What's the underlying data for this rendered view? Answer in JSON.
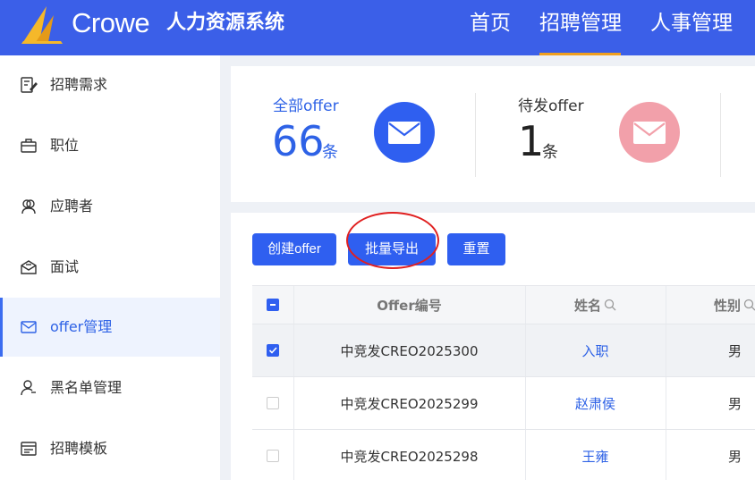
{
  "header": {
    "brand": "Crowe",
    "system_title": "人力资源系统",
    "nav": [
      {
        "label": "首页"
      },
      {
        "label": "招聘管理",
        "active": true
      },
      {
        "label": "人事管理"
      }
    ],
    "colors": {
      "bar": "#3b5fe8",
      "active_underline": "#f0a020"
    }
  },
  "sidebar": {
    "items": [
      {
        "label": "招聘需求",
        "icon": "edit-document-icon"
      },
      {
        "label": "职位",
        "icon": "briefcase-icon"
      },
      {
        "label": "应聘者",
        "icon": "users-icon"
      },
      {
        "label": "面试",
        "icon": "mail-open-icon"
      },
      {
        "label": "offer管理",
        "icon": "mail-icon",
        "active": true
      },
      {
        "label": "黑名单管理",
        "icon": "user-block-icon"
      },
      {
        "label": "招聘模板",
        "icon": "template-icon"
      }
    ]
  },
  "stats": [
    {
      "label": "全部offer",
      "value": "66",
      "unit": "条",
      "icon": "mail-icon",
      "color": "#2f5ff0"
    },
    {
      "label": "待发offer",
      "value": "1",
      "unit": "条",
      "icon": "mail-icon",
      "color": "#f2a0aa"
    }
  ],
  "toolbar": {
    "create_label": "创建offer",
    "export_label": "批量导出",
    "reset_label": "重置"
  },
  "table": {
    "columns": [
      "Offer编号",
      "姓名",
      "性别"
    ],
    "rows": [
      {
        "id": "中竞发CREO2025300",
        "name": "入职",
        "gender": "男",
        "checked": true
      },
      {
        "id": "中竞发CREO2025299",
        "name": "赵肃侯",
        "gender": "男",
        "checked": false
      },
      {
        "id": "中竞发CREO2025298",
        "name": "王雍",
        "gender": "男",
        "checked": false
      }
    ]
  }
}
